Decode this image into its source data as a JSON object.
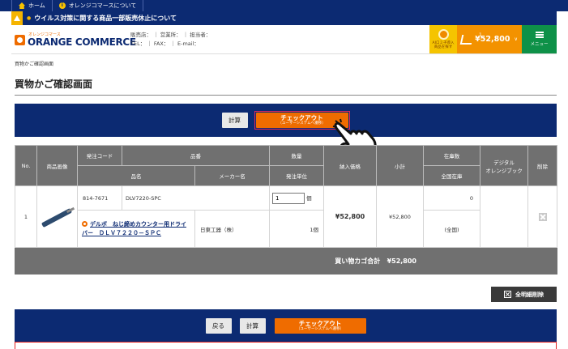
{
  "topnav": {
    "home": "ホーム",
    "about": "オレンジコマースについて"
  },
  "alert": {
    "text": "ウイルス対策に関する商品一部販売休止について"
  },
  "header": {
    "logo_small": "オレンジコマース",
    "logo_name": "ORANGE COMMERCE",
    "store_line1": "販売店： ｜ 営業所： ｜ 担当者：",
    "store_line2": "TEL： ｜ FAX： ｜ E-mail："
  },
  "mascot": {
    "label_line1": "AIロミ子導入",
    "label_line2": "商品を探す"
  },
  "cart": {
    "count": "1",
    "amount": "¥52,800"
  },
  "menu": {
    "label": "メニュー"
  },
  "breadcrumb": "買物かご確認画面",
  "page_title": "買物かご確認画面",
  "actions": {
    "calc": "計算",
    "back": "戻る",
    "checkout_main": "チェックアウト",
    "checkout_sub": "（ユーザーシステムへ遷移）"
  },
  "table": {
    "headers": {
      "no": "No.",
      "image": "商品画像",
      "order_code": "発注コード",
      "product_no": "品番",
      "quantity": "数量",
      "price": "納入価格",
      "subtotal": "小計",
      "stock": "在庫数",
      "digital": "デジタル",
      "digital2": "オレンジブック",
      "delete": "削除",
      "name": "品名",
      "maker": "メーカー名",
      "unit": "発注単位",
      "all_stock": "全国在庫"
    },
    "rows": [
      {
        "no": "1",
        "code": "814-7671",
        "product_no": "DLV7220-SPC",
        "qty": "1",
        "qty_unit": "個",
        "name": "デルボ　ねじ締めカウンター用ドライバー　ＤＬＶ７２２０－ＳＰＣ",
        "maker": "日東工器（株）",
        "unit": "1個",
        "price": "¥52,800",
        "subtotal": "¥52,800",
        "stock": "0",
        "all_stock": "(全国)"
      }
    ],
    "total_label": "買い物カゴ合計",
    "total_value": "¥52,800"
  },
  "delete_all": "全明細削除",
  "colors": {
    "navy": "#0c2a72",
    "orange": "#ef6c00",
    "green": "#0e9148",
    "yellow": "#f5c400"
  }
}
